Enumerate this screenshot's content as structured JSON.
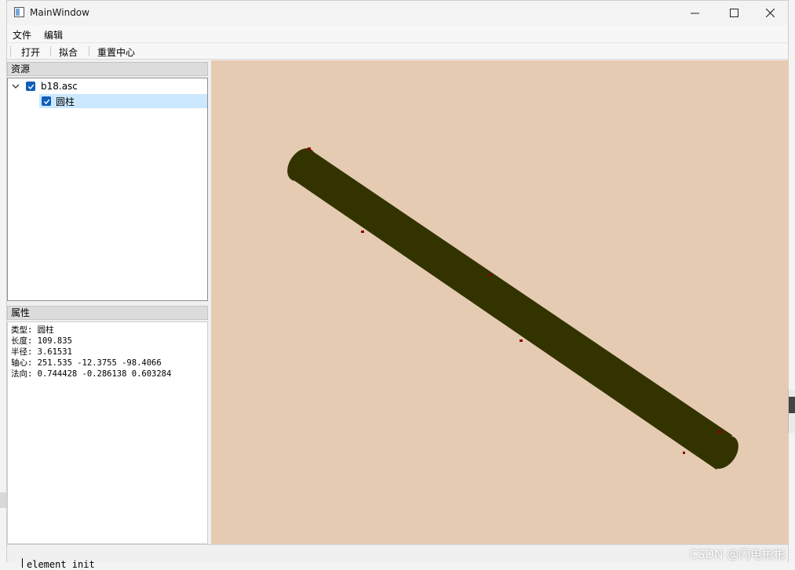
{
  "window": {
    "title": "MainWindow"
  },
  "menubar": {
    "items": [
      "文件",
      "编辑"
    ]
  },
  "toolbar": {
    "buttons": [
      "打开",
      "拟合",
      "重置中心"
    ]
  },
  "resources": {
    "title": "资源",
    "tree": [
      {
        "label": "b18.asc",
        "checked": true,
        "expanded": true
      },
      {
        "label": "圆柱",
        "checked": true,
        "selected": true
      }
    ]
  },
  "properties": {
    "title": "属性",
    "lines": [
      "类型: 圆柱",
      "长度: 109.835",
      "半径: 3.61531",
      "轴心: 251.535 -12.3755 -98.4066",
      "法向: 0.744428 -0.286138 0.603284"
    ]
  },
  "viewport": {
    "background": "#e6cbb3",
    "cylinder_color": "#333300",
    "marker_color": "#8b0000"
  },
  "console": {
    "text": "element init"
  },
  "watermark": {
    "text": "CSDN @闪电彬彬"
  },
  "colors": {
    "accent": "#0f5fb8",
    "selection": "#cce8ff"
  }
}
